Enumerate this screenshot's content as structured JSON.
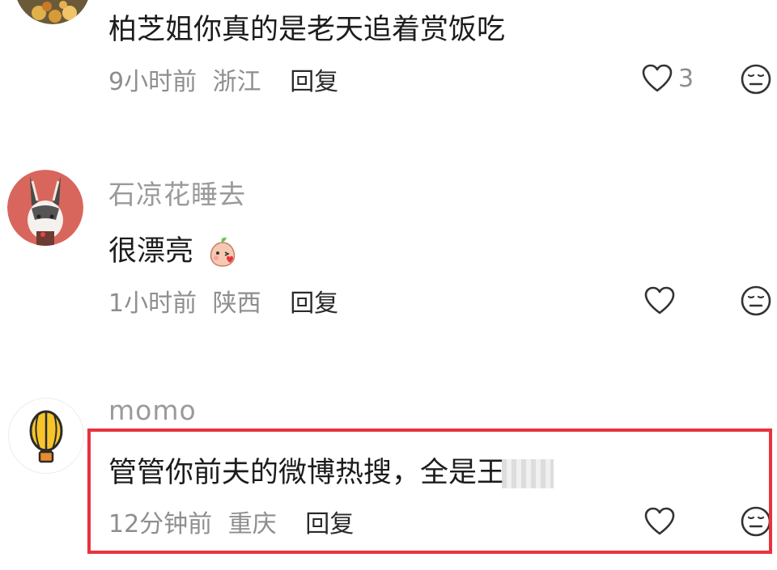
{
  "comments": [
    {
      "text": "柏芝姐你真的是老天追着赏饭吃",
      "time": "9小时前",
      "location": "浙江",
      "reply_label": "回复",
      "like_count": "3"
    },
    {
      "username": "石凉花睡去",
      "text": "很漂亮",
      "time": "1小时前",
      "location": "陕西",
      "reply_label": "回复"
    },
    {
      "username": "momo",
      "text": "管管你前夫的微博热搜，全是王",
      "time": "12分钟前",
      "location": "重庆",
      "reply_label": "回复"
    }
  ],
  "icons": {
    "like": "heart-outline-icon",
    "dislike": "neutral-face-icon"
  },
  "colors": {
    "highlight_border": "#e8333d"
  }
}
